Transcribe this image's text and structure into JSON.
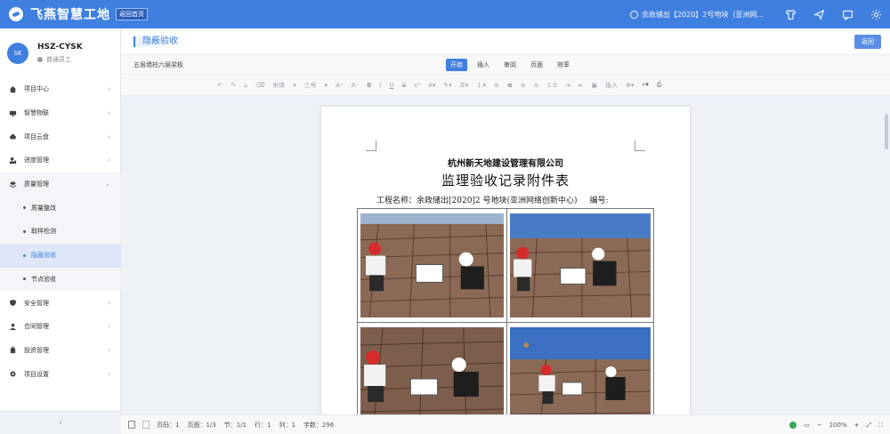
{
  "app": {
    "name": "飞燕智慧工地",
    "home_button": "返回首页",
    "project": "余政储出【2020】2号地块（亚洲网..."
  },
  "top_icons": [
    "shirt-icon",
    "send-icon",
    "message-icon",
    "settings-icon"
  ],
  "user": {
    "avatar_text": "SK",
    "name": "HSZ-CYSK",
    "role": "普通员工"
  },
  "menu": [
    {
      "label": "项目中心",
      "icon": "home-icon"
    },
    {
      "label": "智慧物联",
      "icon": "monitor-icon"
    },
    {
      "label": "项目云盘",
      "icon": "cloud-icon"
    },
    {
      "label": "进度管理",
      "icon": "progress-icon"
    },
    {
      "label": "质量管理",
      "icon": "layers-icon"
    },
    {
      "label": "安全管理",
      "icon": "shield-icon"
    },
    {
      "label": "合同管理",
      "icon": "person-icon"
    },
    {
      "label": "投资管理",
      "icon": "money-icon"
    },
    {
      "label": "项目设置",
      "icon": "gear-icon"
    }
  ],
  "submenu": [
    "质量整改",
    "取样检测",
    "隐蔽验收",
    "节点验收"
  ],
  "collapse_icon": "‹",
  "page": {
    "title": "隐蔽验收",
    "back_button": "返回"
  },
  "document": {
    "name": "五层墙柱六层梁板",
    "tabs": [
      "开始",
      "插入",
      "审阅",
      "页面",
      "效率"
    ],
    "toolbar": {
      "font": "宋体",
      "size": "三号",
      "grow": "A⁺",
      "shrink": "A⁻",
      "bold": "B",
      "italic": "I",
      "underline": "U",
      "strike": "S",
      "line_spacing": "1.0",
      "insert": "插入"
    },
    "company": "杭州新天地建设管理有限公司",
    "form_title": "监理验收记录附件表",
    "project_line": "工程名称：余政储出[2020]2 号地块(亚洲网络创新中心)",
    "number_label": "编号:"
  },
  "status": {
    "page_no": "页码：1",
    "pages": "页面：1/3",
    "section": "节：1/1",
    "row": "行：1",
    "col": "列：1",
    "words": "字数：296",
    "zoom": "100%"
  }
}
